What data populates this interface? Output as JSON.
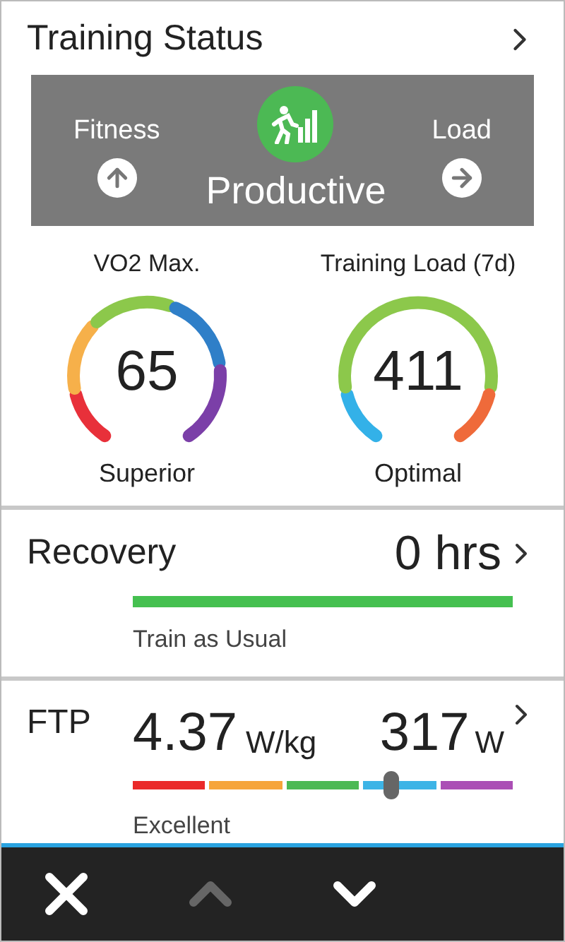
{
  "header": {
    "title": "Training Status"
  },
  "status": {
    "fitness_label": "Fitness",
    "load_label": "Load",
    "status": "Productive"
  },
  "gauges": [
    {
      "kind": "vo2",
      "title": "VO2 Max.",
      "value": "65",
      "rating": "Superior"
    },
    {
      "kind": "load",
      "title": "Training Load (7d)",
      "value": "411",
      "rating": "Optimal"
    }
  ],
  "recovery": {
    "label": "Recovery",
    "value": "0 hrs",
    "advice": "Train as Usual"
  },
  "ftp": {
    "label": "FTP",
    "ratio": "4.37",
    "ratio_unit": "W/kg",
    "power": "317",
    "power_unit": "W",
    "rating": "Excellent"
  },
  "nav": [
    {
      "kind": "close",
      "disabled": false
    },
    {
      "kind": "up",
      "disabled": true
    },
    {
      "kind": "down",
      "disabled": false
    }
  ]
}
